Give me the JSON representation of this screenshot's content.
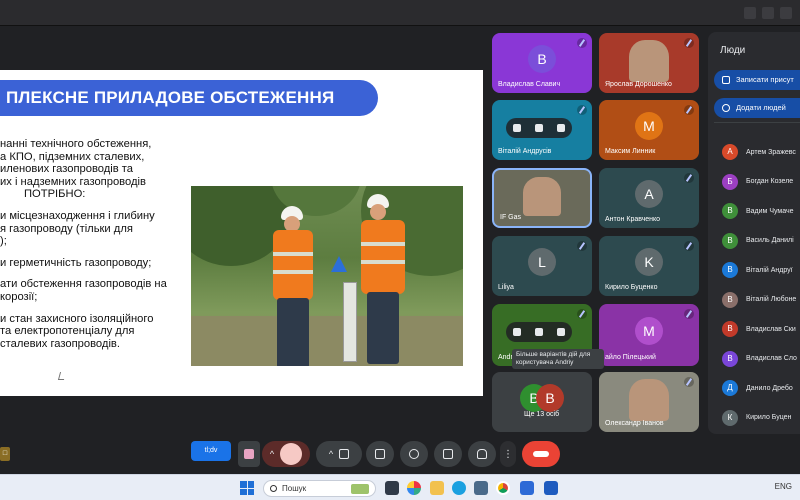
{
  "slide": {
    "title": "ПЛЕКСНЕ ПРИЛАДОВЕ ОБСТЕЖЕННЯ",
    "lines": [
      "нанні технічного обстеження,",
      "а КПО, підземних сталевих,",
      "иленових газопроводів та",
      "их і надземних газопроводів",
      "ПОТРІБНО:",
      "",
      "и місцезнаходження і глибину",
      "я газопроводу (тільки для",
      ");",
      "",
      "и герметичність газопроводу;",
      "",
      "ати обстеження газопроводів на",
      "корозії;",
      "",
      "и стан захисного ізоляційного",
      "та електропотенціалу для",
      "сталевих газопроводів."
    ]
  },
  "tiles": [
    {
      "id": "vladyslav",
      "name": "Владислав Славич",
      "initial": "В",
      "avatar_color": "#7b4ed9",
      "bg": "#8a37d6"
    },
    {
      "id": "yaroslav",
      "name": "Ярослав Дорошенко",
      "initial": "",
      "avatar_color": "#777777",
      "bg": "#a83a2a"
    },
    {
      "id": "vitaliy",
      "name": "Віталій Андрусів",
      "initial": "",
      "avatar_color": "#1976a8",
      "bg": "#167fa1"
    },
    {
      "id": "maksym",
      "name": "Максим Линник",
      "initial": "М",
      "avatar_color": "#e07415",
      "bg": "#b14e15"
    },
    {
      "id": "if-gas",
      "name": "IF Gas",
      "initial": "",
      "avatar_color": "#8a8c7a",
      "bg": "#6a6a5a"
    },
    {
      "id": "anton",
      "name": "Антон Кравченко",
      "initial": "А",
      "avatar_color": "#5f6a6d",
      "bg": "#2d4a4f"
    },
    {
      "id": "liliya",
      "name": "Liliya",
      "initial": "L",
      "avatar_color": "#5f6a6d",
      "bg": "#2d4a4f"
    },
    {
      "id": "kyrylo",
      "name": "Кирило Буценко",
      "initial": "K",
      "avatar_color": "#5f6a6d",
      "bg": "#2d4a4f"
    },
    {
      "id": "andriy",
      "name": "Andr",
      "initial": "",
      "avatar_color": "#3f7f2b",
      "bg": "#376d25"
    },
    {
      "id": "mykhailo",
      "name": "айло Пілецький",
      "initial": "M",
      "avatar_color": "#b04fcc",
      "bg": "#8a33a6"
    },
    {
      "id": "more",
      "name": "Ще 13 осіб",
      "initial": "",
      "avatar_color": "#3c4043",
      "bg": "#3c4043"
    },
    {
      "id": "oleksandr",
      "name": "Олександр Іванов",
      "initial": "",
      "avatar_color": "#777777",
      "bg": "#8a8a7e"
    }
  ],
  "more_avatars": [
    {
      "initial": "В",
      "color": "#2f8f2f"
    },
    {
      "initial": "В",
      "color": "#b23a2a"
    }
  ],
  "tooltip": "Більше варіантів дій для користувача Andriy",
  "panel": {
    "title": "Люди",
    "record_label": "Записати присут",
    "add_label": "Додати людей",
    "people": [
      {
        "initial": "А",
        "name": "Артем Зражевс",
        "color": "#d84a2a"
      },
      {
        "initial": "Б",
        "name": "Богдан Козеле",
        "color": "#9c3fc2"
      },
      {
        "initial": "В",
        "name": "Вадим Чумаче",
        "color": "#3f8f3a"
      },
      {
        "initial": "В",
        "name": "Василь Данилі",
        "color": "#3f8f3a"
      },
      {
        "initial": "В",
        "name": "Віталій Андруї",
        "color": "#1b79d8"
      },
      {
        "initial": "В",
        "name": "Віталій Любоне",
        "color": "#8a6f6a"
      },
      {
        "initial": "В",
        "name": "Владислав Ски",
        "color": "#c23a2a"
      },
      {
        "initial": "В",
        "name": "Владислав Сло",
        "color": "#7a46d9"
      },
      {
        "initial": "Д",
        "name": "Данило Дребо",
        "color": "#1b79d8"
      },
      {
        "initial": "К",
        "name": "Кирило Буцен",
        "color": "#5f6a6d"
      }
    ]
  },
  "controls": {
    "badge": "tl;dv"
  },
  "taskbar": {
    "search_placeholder": "Пошук",
    "tray_text": "ENG"
  }
}
